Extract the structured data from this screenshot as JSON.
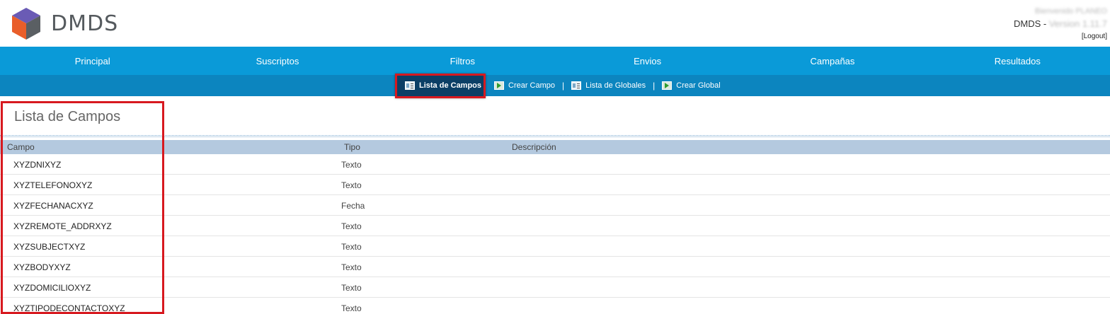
{
  "header": {
    "brand": "DMDS",
    "welcome_text": "Bienvenido PLANEO",
    "version_label": "DMDS - ",
    "version_value": "Version 1.11.7",
    "logout_label": "[Logout]"
  },
  "main_nav": [
    {
      "label": "Principal"
    },
    {
      "label": "Suscriptos"
    },
    {
      "label": "Filtros"
    },
    {
      "label": "Envios"
    },
    {
      "label": "Campañas"
    },
    {
      "label": "Resultados"
    }
  ],
  "sub_nav": {
    "active_label": "Lista de Campos",
    "crear_campo": "Crear Campo",
    "separator": "|",
    "lista_globales": "Lista de Globales",
    "crear_global": "Crear Global"
  },
  "page": {
    "title": "Lista de Campos"
  },
  "table": {
    "headers": [
      "Campo",
      "Tipo",
      "Descripción"
    ],
    "rows": [
      {
        "campo": "XYZDNIXYZ",
        "tipo": "Texto"
      },
      {
        "campo": "XYZTELEFONOXYZ",
        "tipo": "Texto"
      },
      {
        "campo": "XYZFECHANACXYZ",
        "tipo": "Fecha"
      },
      {
        "campo": "XYZREMOTE_ADDRXYZ",
        "tipo": "Texto"
      },
      {
        "campo": "XYZSUBJECTXYZ",
        "tipo": "Texto"
      },
      {
        "campo": "XYZBODYXYZ",
        "tipo": "Texto"
      },
      {
        "campo": "XYZDOMICILIOXYZ",
        "tipo": "Texto"
      },
      {
        "campo": "XYZTIPODECONTACTOXYZ",
        "tipo": "Texto"
      }
    ]
  },
  "colors": {
    "nav_bg": "#0a9ad8",
    "subnav_bg": "#0c85bf",
    "highlight": "#d7191f",
    "table_head_bg": "#b4c9df"
  },
  "icons": {
    "logo": "cube-logo-icon",
    "list": "list-icon",
    "create": "create-icon"
  }
}
